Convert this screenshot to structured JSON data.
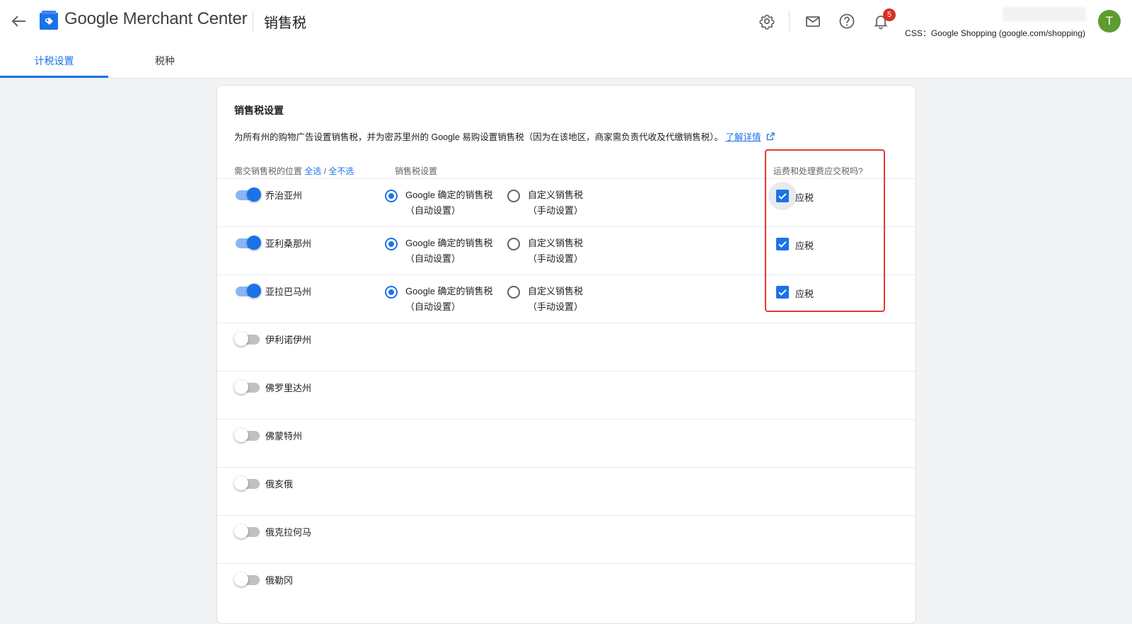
{
  "app": {
    "brand": "Google Merchant Center",
    "page_title": "销售税"
  },
  "header": {
    "notification_count": "5",
    "account": "CSS：Google Shopping (google.com/shopping)",
    "avatar_letter": "T",
    "icons": [
      "back-arrow-icon",
      "merchant-center-logo",
      "gear-icon",
      "mail-icon",
      "help-icon",
      "bell-icon"
    ]
  },
  "tabs": [
    {
      "label": "计税设置",
      "active": true
    },
    {
      "label": "税种",
      "active": false
    }
  ],
  "card": {
    "title": "销售税设置",
    "description": "为所有州的购物广告设置销售税，并为密苏里州的 Google 易购设置销售税（因为在该地区，商家需负责代收及代缴销售税）。",
    "learn_more": "了解详情",
    "col_location": "需交销售税的位置",
    "select_all": "全选",
    "separator": " / ",
    "select_none": "全不选",
    "col_tax_setting": "销售税设置",
    "col_shipping": "运费和处理费应交税吗?"
  },
  "options": {
    "google_line1": "Google 确定的销售税",
    "google_line2": "（自动设置）",
    "custom_line1": "自定义销售税",
    "custom_line2": "（手动设置）",
    "taxable": "应税"
  },
  "states": [
    {
      "name": "乔治亚州",
      "enabled": true,
      "tax_mode": "google",
      "shipping_taxable": true
    },
    {
      "name": "亚利桑那州",
      "enabled": true,
      "tax_mode": "google",
      "shipping_taxable": true
    },
    {
      "name": "亚拉巴马州",
      "enabled": true,
      "tax_mode": "google",
      "shipping_taxable": true
    },
    {
      "name": "伊利诺伊州",
      "enabled": false
    },
    {
      "name": "佛罗里达州",
      "enabled": false
    },
    {
      "name": "佛蒙特州",
      "enabled": false
    },
    {
      "name": "俄亥俄",
      "enabled": false
    },
    {
      "name": "俄克拉何马",
      "enabled": false
    },
    {
      "name": "俄勒冈",
      "enabled": false
    }
  ],
  "colors": {
    "accent": "#1a73e8",
    "highlight_box": "#e53935",
    "avatar": "#5e9c2f",
    "badge": "#d93025"
  }
}
